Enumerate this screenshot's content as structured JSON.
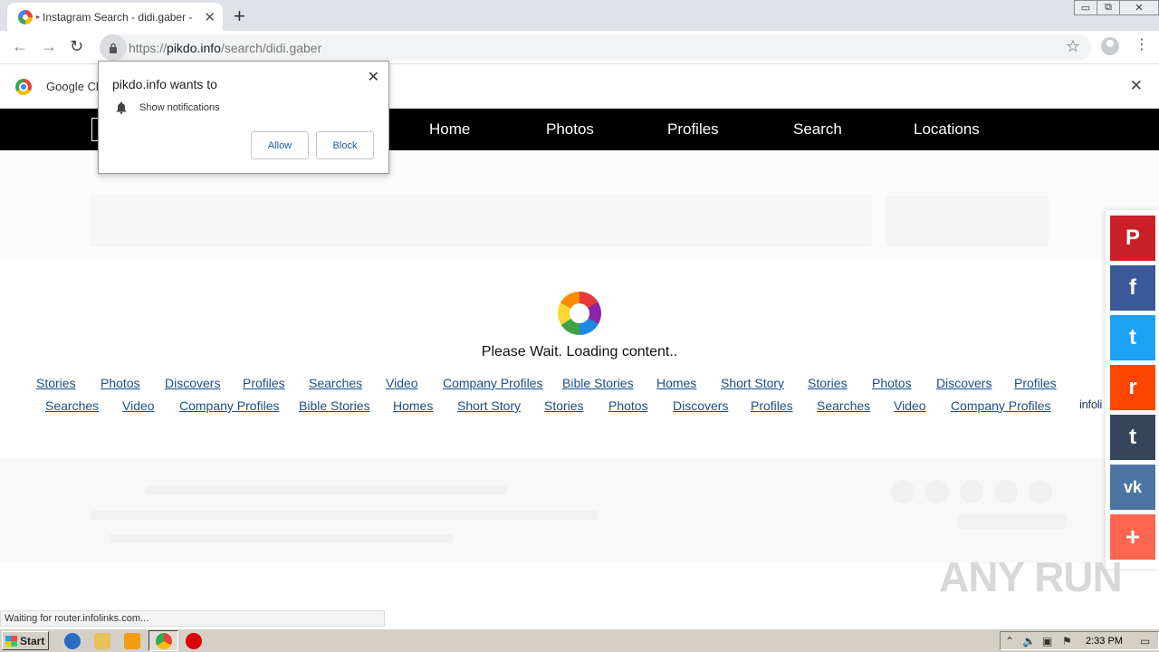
{
  "browser": {
    "tab_title": "Instagram Search - didi.gaber - Se",
    "tab_sound": "▸",
    "tab_close": "✕",
    "new_tab": "+",
    "window_minimize": "▭",
    "window_restore": "⧉",
    "window_close": "✕",
    "back": "←",
    "forward": "→",
    "reload": "↻",
    "url_scheme": "https://",
    "url_host": "pikdo.info",
    "url_path": "/search/didi.gaber",
    "star": "☆",
    "menu": "⋮"
  },
  "infobar": {
    "text": "Google Ch",
    "close": "✕"
  },
  "popup": {
    "title": "pikdo.info wants to",
    "permission": "Show notifications",
    "allow": "Allow",
    "block": "Block",
    "close": "✕"
  },
  "site_nav": {
    "items": [
      "Home",
      "Photos",
      "Profiles",
      "Search",
      "Locations"
    ]
  },
  "loader": {
    "text": "Please Wait. Loading content.."
  },
  "links_row1": [
    "Stories",
    "Photos",
    "Discovers",
    "Profiles",
    "Searches",
    "Video",
    "Company Profiles",
    "Bible Stories",
    "Homes",
    "Short Story",
    "Stories",
    "Photos",
    "Discovers",
    "Profiles"
  ],
  "links_row2": [
    "Searches",
    "Video",
    "Company Profiles",
    "Bible Stories",
    "Homes",
    "Short Story",
    "Stories",
    "Photos",
    "Discovers",
    "Profiles",
    "Searches",
    "Video",
    "Company Profiles"
  ],
  "infolinks_tag": "infoli",
  "share": {
    "pinterest": "P",
    "facebook": "f",
    "twitter": "t",
    "reddit": "r",
    "tumblr": "t",
    "vk": "vk",
    "more": "+"
  },
  "colors": {
    "pinterest": "#cb2027",
    "facebook": "#3b5998",
    "twitter": "#1da1f2",
    "reddit": "#ff4500",
    "tumblr": "#35465c",
    "vk": "#4c75a3",
    "more": "#ff6550"
  },
  "watermark": "ANY RUN",
  "status": "Waiting for router.infolinks.com...",
  "taskbar": {
    "start": "Start",
    "clock": "2:33 PM"
  }
}
